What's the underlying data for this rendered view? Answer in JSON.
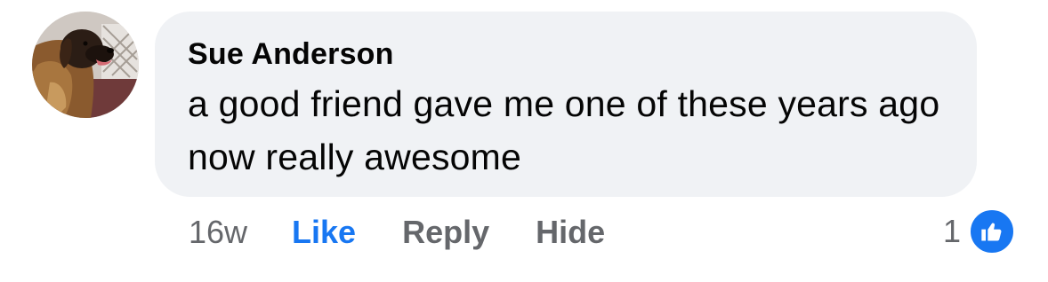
{
  "comment": {
    "author": "Sue Anderson",
    "text": "a good friend gave me one of these years ago now really awesome",
    "timestamp": "16w",
    "reaction_count": "1"
  },
  "actions": {
    "like_label": "Like",
    "reply_label": "Reply",
    "hide_label": "Hide"
  },
  "icons": {
    "avatar": "dog-profile-photo",
    "reaction": "thumbs-up-icon"
  },
  "colors": {
    "bubble_background": "#f0f2f5",
    "like_active": "#1877f2",
    "secondary_text": "#65676b",
    "primary_text": "#050505"
  }
}
